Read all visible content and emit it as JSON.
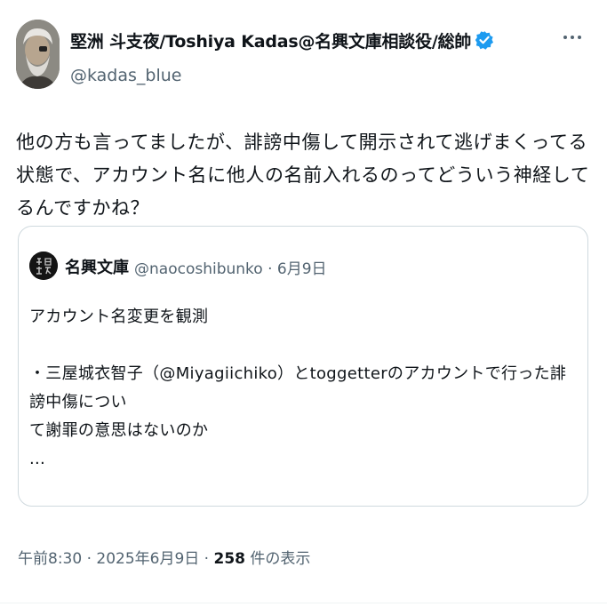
{
  "author": {
    "display_name": "堅洲 斗支夜/Toshiya Kadas@名興文庫相談役/総帥",
    "handle": "@kadas_blue",
    "verified_icon": "verified-badge-icon",
    "accent": "#1d9bf0"
  },
  "tweet": {
    "text": "他の方も言ってましたが、誹謗中傷して開示されて逃げまくってる状態で、アカウント名に他人の名前入れるのってどういう神経してるんですかね？"
  },
  "quote": {
    "name": "名興文庫",
    "handle_date": "@naocoshibunko · 6月9日",
    "lines": [
      "アカウント名変更を観測",
      "",
      "・三屋城衣智子（@Miyagiichiko）とtoggetterのアカウントで行った誹謗中傷につい",
      "て謝罪の意思はないのか",
      "..."
    ]
  },
  "meta": {
    "time": "午前8:30 · 2025年6月9日 · ",
    "views_count": "258",
    "views_label": " 件の表示"
  },
  "icons": [
    "avatar",
    "verified-badge-icon",
    "more-options-icon",
    "quote-avatar"
  ]
}
